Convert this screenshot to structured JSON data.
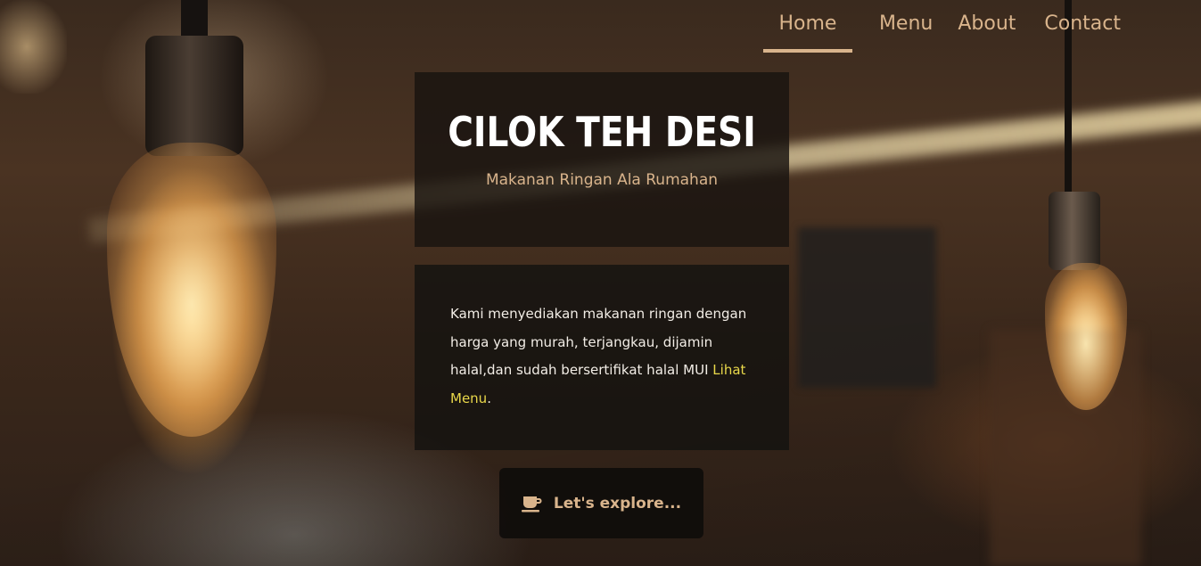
{
  "nav": {
    "items": [
      {
        "label": "Home",
        "active": true
      },
      {
        "label": "Menu",
        "active": false
      },
      {
        "label": "About",
        "active": false
      },
      {
        "label": "Contact",
        "active": false
      }
    ]
  },
  "hero": {
    "title": "CILOK TEH DESI",
    "tagline": "Makanan Ringan Ala Rumahan"
  },
  "description": {
    "text": "Kami menyediakan makanan ringan dengan harga yang murah, terjangkau, dijamin halal,dan sudah bersertifikat halal MUI ",
    "link_label": "Lihat Menu",
    "suffix": "."
  },
  "cta": {
    "label": "Let's explore...",
    "icon": "coffee-icon"
  },
  "colors": {
    "accent": "#d9b48c",
    "link": "#e9d84a",
    "card_bg": "#19140f",
    "title_text": "#ffffff"
  }
}
